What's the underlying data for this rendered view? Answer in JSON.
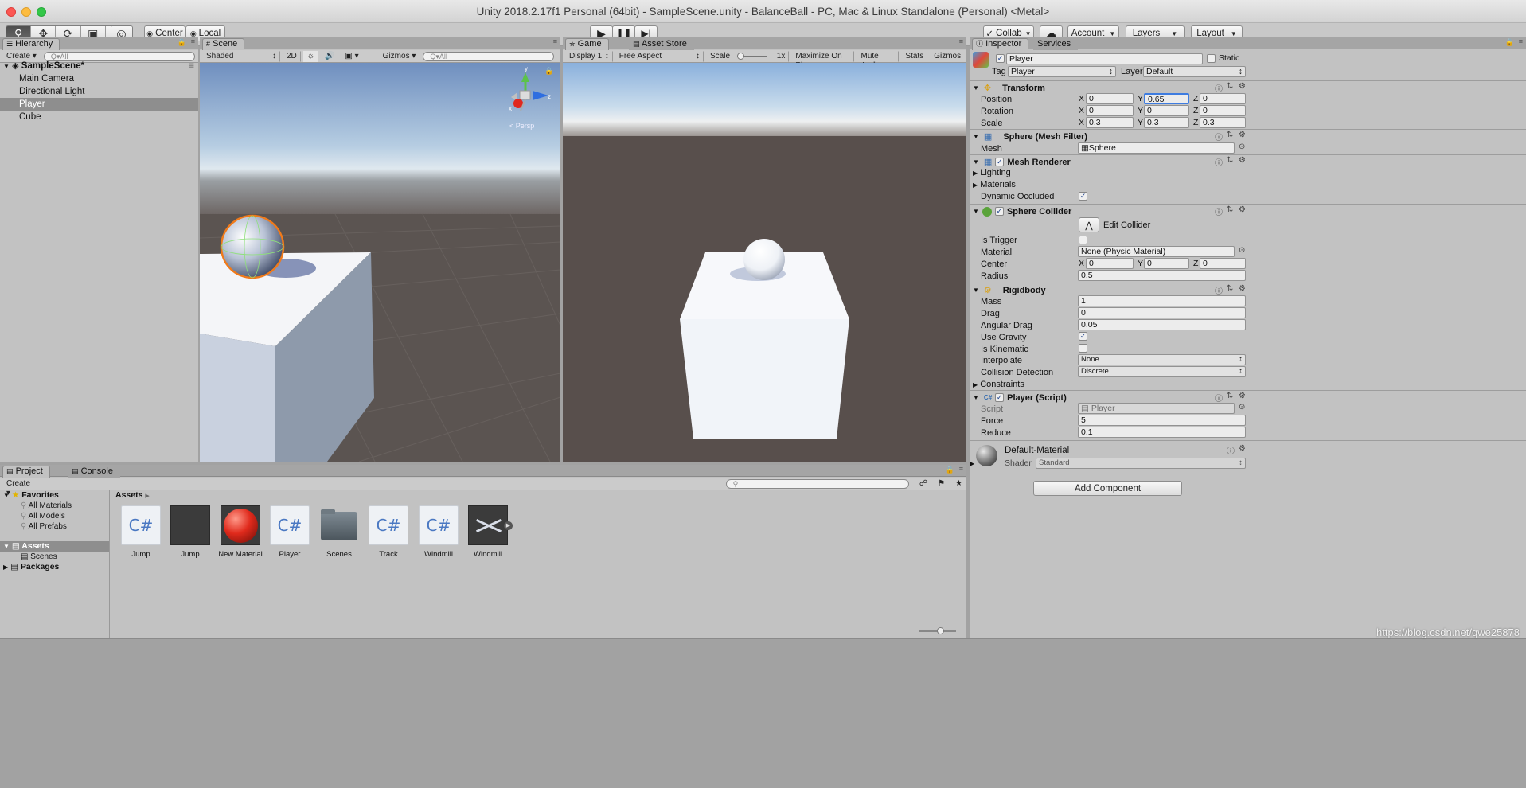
{
  "window": {
    "title": "Unity 2018.2.17f1 Personal (64bit) - SampleScene.unity - BalanceBall - PC, Mac & Linux Standalone (Personal) <Metal>"
  },
  "toolbar": {
    "tools": [
      "hand-icon",
      "move-icon",
      "rotate-icon",
      "scale-icon",
      "rect-icon",
      "transform-icon"
    ],
    "pivot": "Center",
    "space": "Local",
    "collab": "Collab",
    "account": "Account",
    "layers": "Layers",
    "layout": "Layout"
  },
  "hierarchy": {
    "tab": "Hierarchy",
    "create": "Create",
    "search_placeholder": "All",
    "scene": "SampleScene*",
    "items": [
      "Main Camera",
      "Directional Light",
      "Player",
      "Cube"
    ],
    "selected": "Player"
  },
  "scene_view": {
    "tab": "Scene",
    "shading": "Shaded",
    "mode_2d": "2D",
    "gizmos": "Gizmos",
    "search_placeholder": "All",
    "projection": "Persp",
    "axes": {
      "x": "x",
      "y": "y",
      "z": "z"
    }
  },
  "game_view": {
    "tab": "Game",
    "tab2": "Asset Store",
    "display": "Display 1",
    "aspect": "Free Aspect",
    "scale_label": "Scale",
    "scale_value": "1x",
    "buttons": [
      "Maximize On Play",
      "Mute Audio",
      "Stats",
      "Gizmos"
    ]
  },
  "inspector": {
    "tab": "Inspector",
    "tab2": "Services",
    "object_name": "Player",
    "static_label": "Static",
    "tag_label": "Tag",
    "tag": "Player",
    "layer_label": "Layer",
    "layer": "Default",
    "transform": {
      "title": "Transform",
      "rows": [
        {
          "label": "Position",
          "x": "0",
          "y": "0.65",
          "z": "0"
        },
        {
          "label": "Rotation",
          "x": "0",
          "y": "0",
          "z": "0"
        },
        {
          "label": "Scale",
          "x": "0.3",
          "y": "0.3",
          "z": "0.3"
        }
      ]
    },
    "mesh_filter": {
      "title": "Sphere (Mesh Filter)",
      "mesh_label": "Mesh",
      "mesh": "Sphere"
    },
    "mesh_renderer": {
      "title": "Mesh Renderer",
      "lighting": "Lighting",
      "materials": "Materials",
      "dynamic": "Dynamic Occluded"
    },
    "sphere_collider": {
      "title": "Sphere Collider",
      "edit": "Edit Collider",
      "is_trigger": "Is Trigger",
      "material_label": "Material",
      "material": "None (Physic Material)",
      "center_label": "Center",
      "cx": "0",
      "cy": "0",
      "cz": "0",
      "radius_label": "Radius",
      "radius": "0.5"
    },
    "rigidbody": {
      "title": "Rigidbody",
      "mass_label": "Mass",
      "mass": "1",
      "drag_label": "Drag",
      "drag": "0",
      "angular_label": "Angular Drag",
      "angular": "0.05",
      "gravity_label": "Use Gravity",
      "kinematic_label": "Is Kinematic",
      "interpolate_label": "Interpolate",
      "interpolate": "None",
      "collision_label": "Collision Detection",
      "collision": "Discrete",
      "constraints": "Constraints"
    },
    "player_script": {
      "title": "Player (Script)",
      "script_label": "Script",
      "script": "Player",
      "force_label": "Force",
      "force": "5",
      "reduce_label": "Reduce",
      "reduce": "0.1"
    },
    "material": {
      "name": "Default-Material",
      "shader_label": "Shader",
      "shader": "Standard"
    },
    "add_component": "Add Component"
  },
  "project": {
    "tab": "Project",
    "tab2": "Console",
    "create": "Create",
    "favorites": "Favorites",
    "favorite_items": [
      "All Materials",
      "All Models",
      "All Prefabs"
    ],
    "assets_root": "Assets",
    "scenes": "Scenes",
    "packages": "Packages",
    "breadcrumb": "Assets",
    "assets": [
      {
        "name": "Jump",
        "kind": "script"
      },
      {
        "name": "Jump",
        "kind": "dark"
      },
      {
        "name": "New Material",
        "kind": "material"
      },
      {
        "name": "Player",
        "kind": "script"
      },
      {
        "name": "Scenes",
        "kind": "folder"
      },
      {
        "name": "Track",
        "kind": "script"
      },
      {
        "name": "Windmill",
        "kind": "script"
      },
      {
        "name": "Windmill",
        "kind": "model"
      }
    ]
  },
  "watermark": "https://blog.csdn.net/qwe25878"
}
